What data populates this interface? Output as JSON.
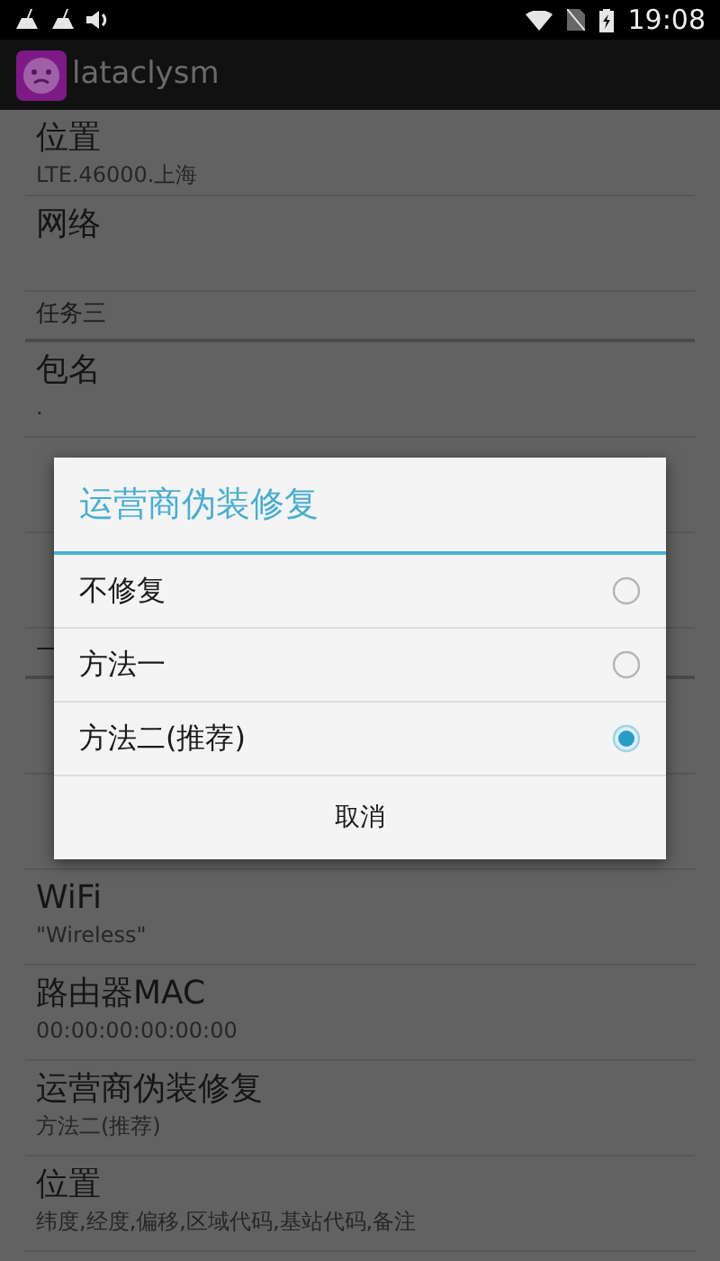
{
  "status_bar": {
    "time": "19:08"
  },
  "app_bar": {
    "title": "lataclysm"
  },
  "list": [
    {
      "kind": "row",
      "title": "位置",
      "subtitle": "LTE.46000.上海"
    },
    {
      "kind": "row",
      "title": "网络"
    },
    {
      "kind": "header",
      "title": "任务三"
    },
    {
      "kind": "row",
      "title": "包名",
      "subtitle": "."
    },
    {
      "kind": "row"
    },
    {
      "kind": "row"
    },
    {
      "kind": "header",
      "title": "一"
    },
    {
      "kind": "row"
    },
    {
      "kind": "row"
    },
    {
      "kind": "row",
      "title": "WiFi",
      "subtitle": "\"Wireless\""
    },
    {
      "kind": "row",
      "title": "路由器MAC",
      "subtitle": "00:00:00:00:00:00"
    },
    {
      "kind": "row",
      "title": "运营商伪装修复",
      "subtitle": "方法二(推荐)"
    },
    {
      "kind": "row",
      "title": "位置",
      "subtitle": "纬度,经度,偏移,区域代码,基站代码,备注"
    }
  ],
  "dialog": {
    "title": "运营商伪装修复",
    "options": [
      {
        "label": "不修复",
        "selected": false
      },
      {
        "label": "方法一",
        "selected": false
      },
      {
        "label": "方法二(推荐)",
        "selected": true
      }
    ],
    "button": "取消"
  }
}
